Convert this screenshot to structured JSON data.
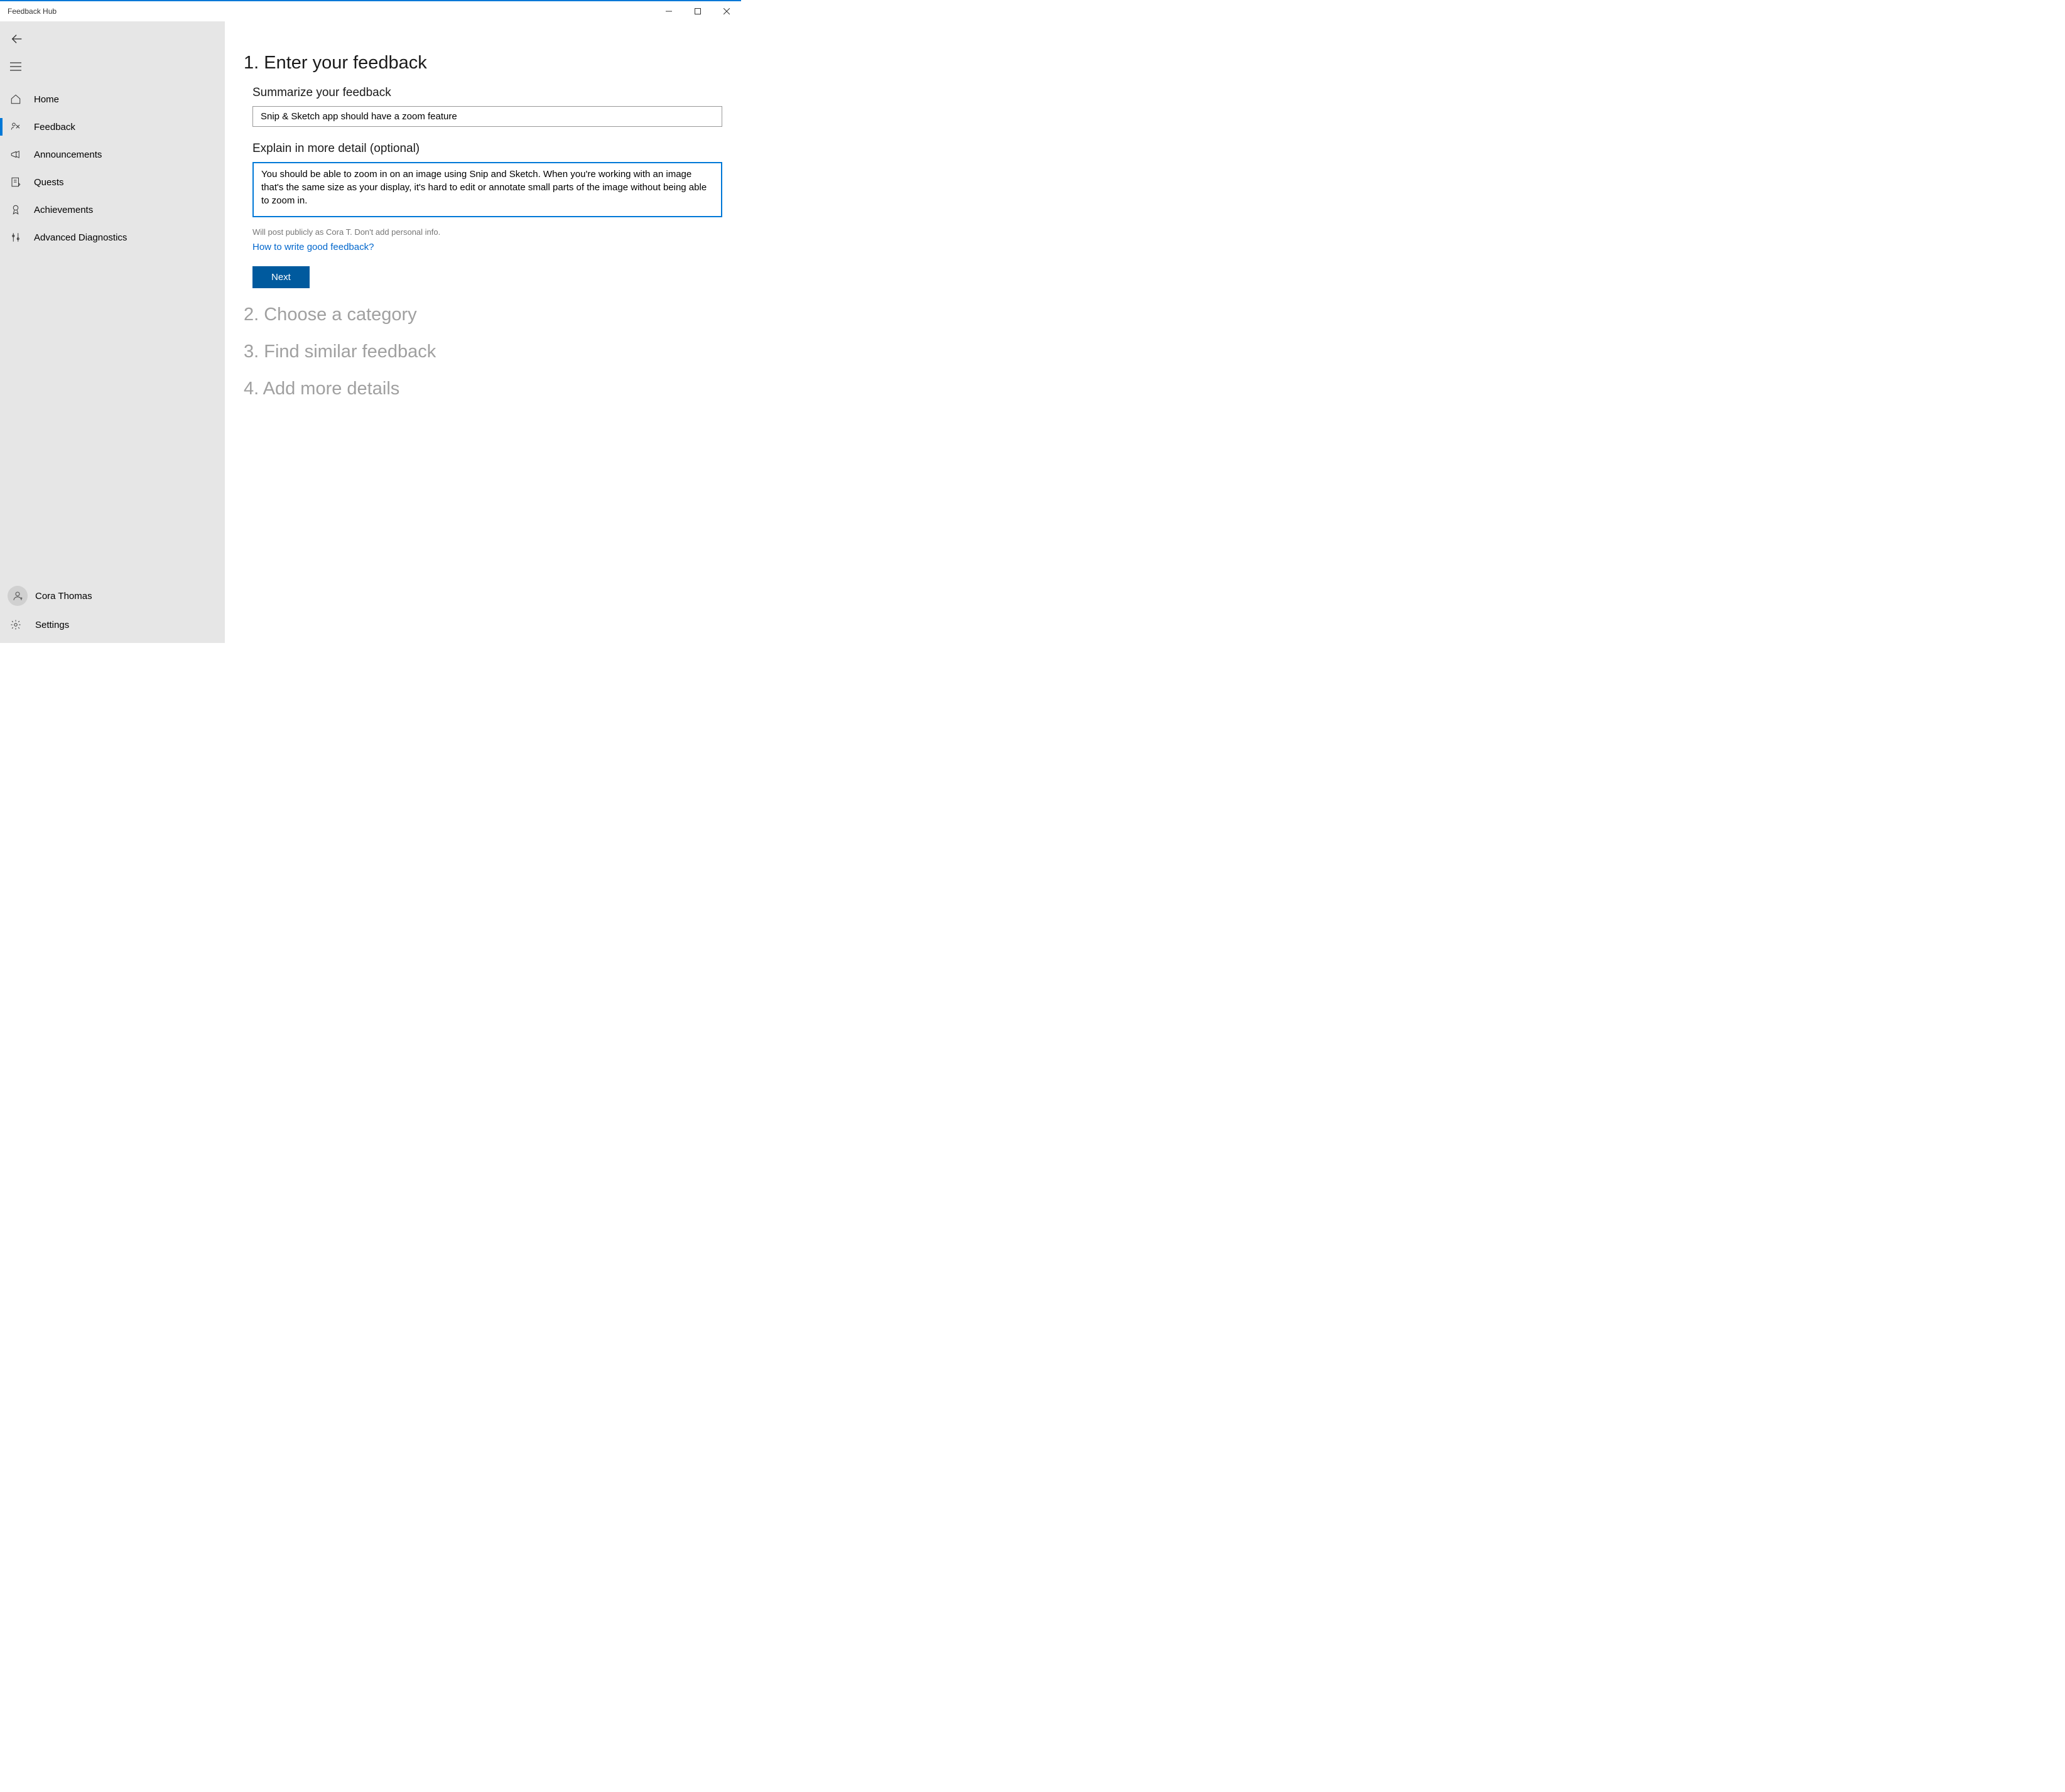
{
  "titlebar": {
    "title": "Feedback Hub"
  },
  "sidebar": {
    "items": [
      {
        "label": "Home"
      },
      {
        "label": "Feedback"
      },
      {
        "label": "Announcements"
      },
      {
        "label": "Quests"
      },
      {
        "label": "Achievements"
      },
      {
        "label": "Advanced Diagnostics"
      }
    ],
    "account_name": "Cora Thomas",
    "settings_label": "Settings"
  },
  "main": {
    "step1_heading": "1. Enter your feedback",
    "summarize_label": "Summarize your feedback",
    "summary_value": "Snip & Sketch app should have a zoom feature",
    "detail_label": "Explain in more detail (optional)",
    "detail_value": "You should be able to zoom in on an image using Snip and Sketch. When you're working with an image that's the same size as your display, it's hard to edit or annotate small parts of the image without being able to zoom in.",
    "privacy_hint": "Will post publicly as Cora T. Don't add personal info.",
    "howto_link": "How to write good feedback?",
    "next_label": "Next",
    "step2_heading": "2. Choose a category",
    "step3_heading": "3. Find similar feedback",
    "step4_heading": "4. Add more details"
  }
}
